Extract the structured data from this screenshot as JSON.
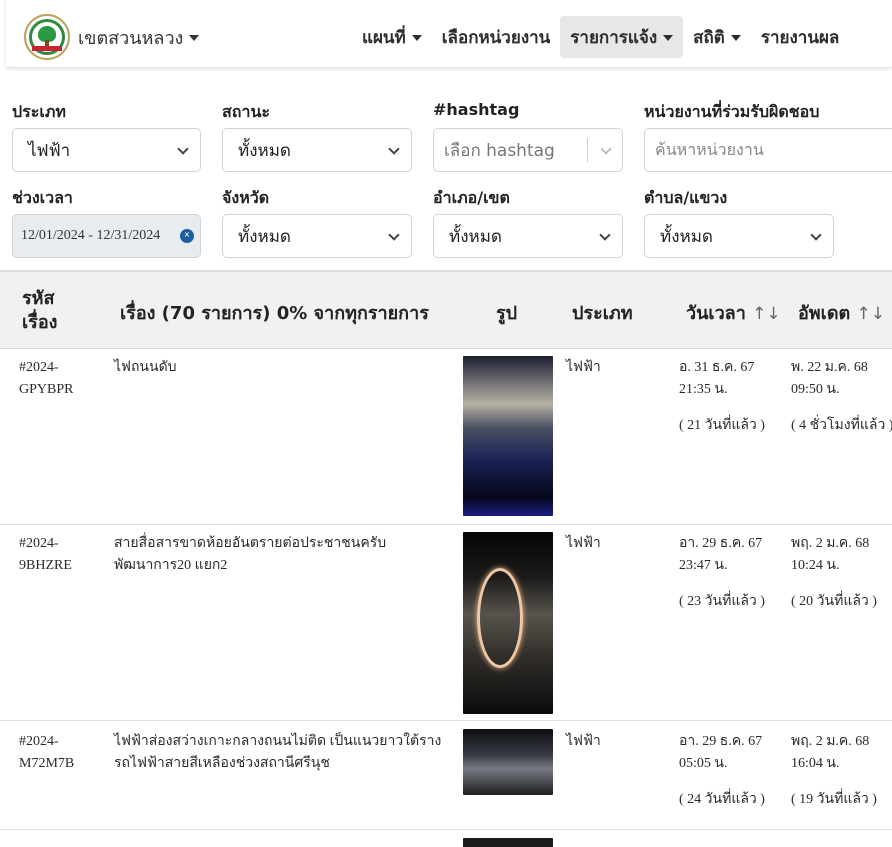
{
  "brand": {
    "name": "เขตสวนหลวง"
  },
  "nav": {
    "map": "แผนที่",
    "select_agency": "เลือกหน่วยงาน",
    "reports": "รายการแจ้ง",
    "stats": "สถิติ",
    "results": "รายงานผล"
  },
  "filters": {
    "type_label": "ประเภท",
    "type_value": "ไฟฟ้า",
    "status_label": "สถานะ",
    "status_value": "ทั้งหมด",
    "hashtag_label": "#hashtag",
    "hashtag_placeholder": "เลือก hashtag",
    "agency_label": "หน่วยงานที่ร่วมรับผิดชอบ",
    "agency_placeholder": "ค้นหาหน่วยงาน",
    "period_label": "ช่วงเวลา",
    "period_value": "12/01/2024 - 12/31/2024",
    "province_label": "จังหวัด",
    "province_value": "ทั้งหมด",
    "district_label": "อำเภอ/เขต",
    "district_value": "ทั้งหมด",
    "subdistrict_label": "ตำบล/แขวง",
    "subdistrict_value": "ทั้งหมด"
  },
  "table": {
    "headers": {
      "id_line1": "รหัส",
      "id_line2": "เรื่อง",
      "subject": "เรื่อง (70 รายการ) 0% จากทุกรายการ",
      "photo": "รูป",
      "type": "ประเภท",
      "datetime": "วันเวลา",
      "updated": "อัพเดต",
      "sort_glyph": "↑↓"
    },
    "rows": [
      {
        "id_line1": "#2024-",
        "id_line2": "GPYBPR",
        "subject_line1": "ไฟถนนดับ",
        "subject_line2": "",
        "type": "ไฟฟ้า",
        "date_line1": "อ. 31 ธ.ค. 67",
        "date_line2": "21:35 น.",
        "date_ago": "( 21 วันที่แล้ว )",
        "upd_line1": "พ. 22 ม.ค. 68",
        "upd_line2": "09:50 น.",
        "upd_ago": "( 4 ชั่วโมงที่แล้ว )"
      },
      {
        "id_line1": "#2024-",
        "id_line2": "9BHZRE",
        "subject_line1": "สายสื่อสารขาดห้อยอันตรายต่อประชาชนครับ",
        "subject_line2": "พัฒนาการ20 แยก2",
        "type": "ไฟฟ้า",
        "date_line1": "อา. 29 ธ.ค. 67",
        "date_line2": "23:47 น.",
        "date_ago": "( 23 วันที่แล้ว )",
        "upd_line1": "พฤ. 2 ม.ค. 68",
        "upd_line2": "10:24 น.",
        "upd_ago": "( 20 วันที่แล้ว )"
      },
      {
        "id_line1": "#2024-",
        "id_line2": "M72M7B",
        "subject_line1": "ไฟฟ้าส่องสว่างเกาะกลางถนนไม่ติด เป็นแนวยาวใต้ราง",
        "subject_line2": "รถไฟฟ้าสายสีเหลืองช่วงสถานีศรีนุช",
        "type": "ไฟฟ้า",
        "date_line1": "อา. 29 ธ.ค. 67",
        "date_line2": "05:05 น.",
        "date_ago": "( 24 วันที่แล้ว )",
        "upd_line1": "พฤ. 2 ม.ค. 68",
        "upd_line2": "16:04 น.",
        "upd_ago": "( 19 วันที่แล้ว )"
      }
    ]
  }
}
